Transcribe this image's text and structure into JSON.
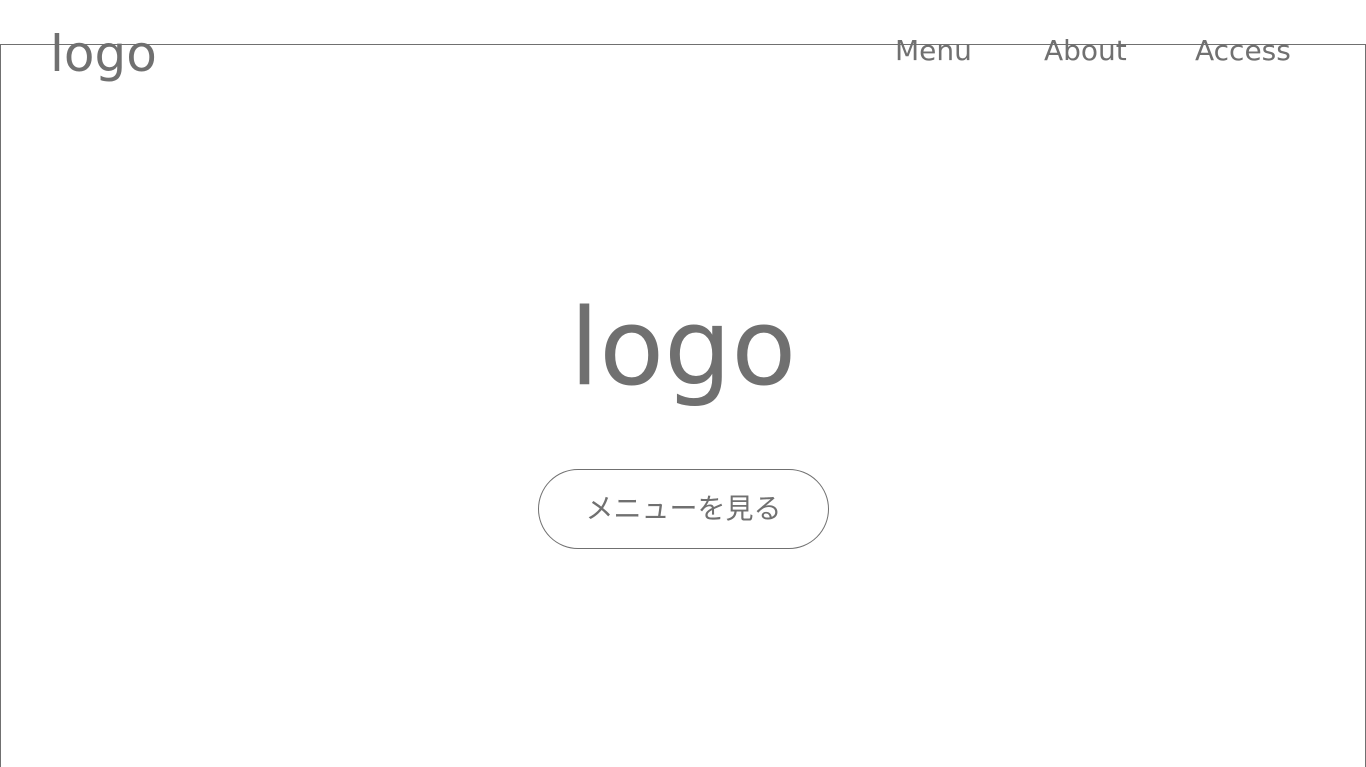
{
  "header": {
    "logo_text": "logo"
  },
  "nav": {
    "items": [
      {
        "label": "Menu"
      },
      {
        "label": "About"
      },
      {
        "label": "Access"
      }
    ]
  },
  "hero": {
    "logo_text": "logo",
    "cta_label": "メニューを見る"
  },
  "colors": {
    "text": "#707070",
    "border": "#707070",
    "background": "#ffffff"
  }
}
